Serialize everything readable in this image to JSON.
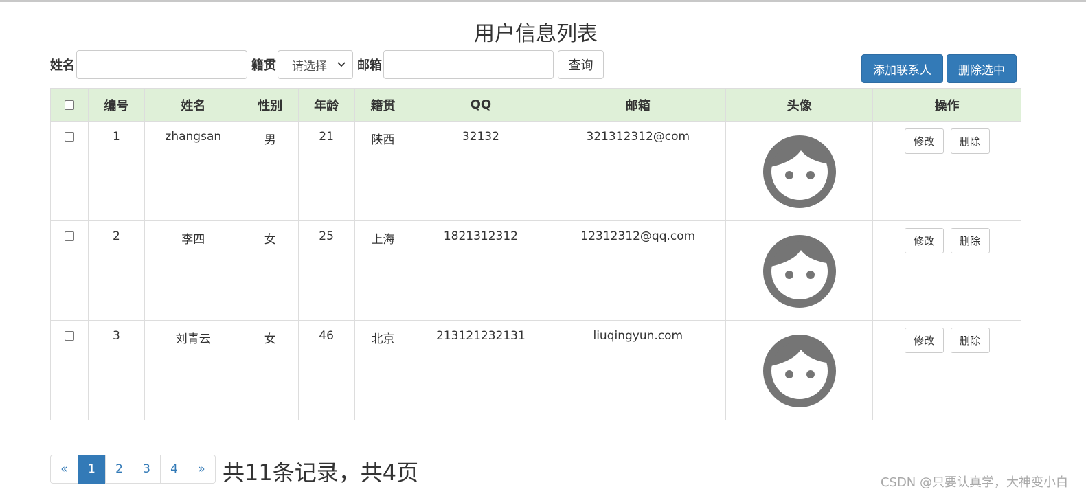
{
  "page": {
    "title": "用户信息列表"
  },
  "search": {
    "name_label": "姓名",
    "name_value": "",
    "hometown_label": "籍贯",
    "hometown_selected": "请选择",
    "email_label": "邮箱",
    "email_value": "",
    "query_label": "查询"
  },
  "actions": {
    "add_label": "添加联系人",
    "delete_selected_label": "删除选中"
  },
  "table": {
    "headers": [
      "编号",
      "姓名",
      "性别",
      "年龄",
      "籍贯",
      "QQ",
      "邮箱",
      "头像",
      "操作"
    ],
    "rows": [
      {
        "id": "1",
        "name": "zhangsan",
        "gender": "男",
        "age": "21",
        "hometown": "陕西",
        "qq": "32132",
        "email": "321312312@com",
        "edit": "修改",
        "delete": "删除"
      },
      {
        "id": "2",
        "name": "李四",
        "gender": "女",
        "age": "25",
        "hometown": "上海",
        "qq": "1821312312",
        "email": "12312312@qq.com",
        "edit": "修改",
        "delete": "删除"
      },
      {
        "id": "3",
        "name": "刘青云",
        "gender": "女",
        "age": "46",
        "hometown": "北京",
        "qq": "213121232131",
        "email": "liuqingyun.com",
        "edit": "修改",
        "delete": "删除"
      }
    ],
    "avatar_icon": "user-face-icon",
    "avatar_color": "#757575"
  },
  "pagination": {
    "prev": "«",
    "pages": [
      "1",
      "2",
      "3",
      "4"
    ],
    "active_page": "1",
    "next": "»",
    "summary": "共11条记录，共4页"
  },
  "watermark": "CSDN @只要认真学，大神变小白",
  "colors": {
    "primary": "#337ab7",
    "header_bg": "#dff0d8",
    "border": "#dddddd"
  }
}
